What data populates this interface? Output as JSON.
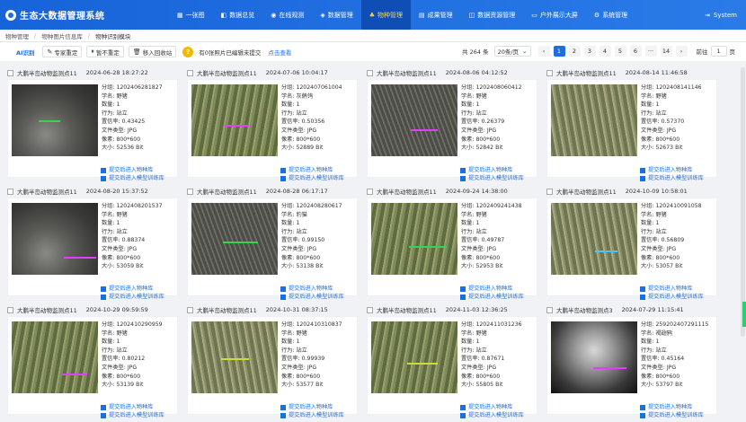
{
  "app": {
    "title": "生态大数据管理系统",
    "system_label": "System"
  },
  "nav": [
    {
      "label": "一张图",
      "icon": "map-icon"
    },
    {
      "label": "数据总览",
      "icon": "dashboard-icon"
    },
    {
      "label": "在线观测",
      "icon": "monitor-icon"
    },
    {
      "label": "数据管理",
      "icon": "data-icon"
    },
    {
      "label": "物种管理",
      "icon": "species-icon",
      "active": true
    },
    {
      "label": "成果管理",
      "icon": "result-icon"
    },
    {
      "label": "数据资源管理",
      "icon": "resource-icon"
    },
    {
      "label": "户外展示大屏",
      "icon": "screen-icon"
    },
    {
      "label": "系统管理",
      "icon": "gear-icon"
    }
  ],
  "breadcrumb": [
    "物种管理",
    "物种图片信息库",
    "物种识别模块"
  ],
  "toolbar": {
    "ai_label": "AI识别",
    "expert_label": "专家重定",
    "pause_label": "暂不重定",
    "move_label": "移入回收站",
    "notice": "有0张照片已编辑未提交",
    "notice_link": "点击查看"
  },
  "pager": {
    "total": "共 264 条",
    "size": "20条/页",
    "pages": [
      "1",
      "2",
      "3",
      "4",
      "5",
      "6",
      "···",
      "14"
    ],
    "current": "1",
    "goto_label": "前往",
    "goto_value": "1",
    "page_unit": "页"
  },
  "card_labels": {
    "group": "分组:",
    "name": "学名:",
    "count": "数量:",
    "behavior": "行为:",
    "conf": "置信率:",
    "format": "文件类型:",
    "pixels": "像素:",
    "size": "大小:",
    "link1": "提交后进入物种库",
    "link2": "提交后进入模型训练库"
  },
  "cards": [
    {
      "station": "大鹏半岛动物监测点11",
      "time": "2024-06-28 18:27:22",
      "group": "1202406281827",
      "name": "野猪",
      "count": "1",
      "behavior": "站立",
      "conf": "0.43425",
      "format": "JPG",
      "pixels": "800*600",
      "size": "52536 Bit",
      "photo": "night",
      "line": "#39d353"
    },
    {
      "station": "大鹏半岛动物监测点11",
      "time": "2024-07-06 10:04:17",
      "group": "1202407061004",
      "name": "灰鹡鸰",
      "count": "1",
      "behavior": "站立",
      "conf": "0.50356",
      "format": "JPG",
      "pixels": "800*600",
      "size": "52889 Bit",
      "photo": "day",
      "line": "#e040fb"
    },
    {
      "station": "大鹏半岛动物监测点11",
      "time": "2024-08-06 04:12:52",
      "group": "1202408060412",
      "name": "野猪",
      "count": "1",
      "behavior": "站立",
      "conf": "0.26379",
      "format": "JPG",
      "pixels": "800*600",
      "size": "52842 Bit",
      "photo": "night2",
      "line": "#e040fb"
    },
    {
      "station": "大鹏半岛动物监测点11",
      "time": "2024-08-14 11:46:58",
      "group": "1202408141146",
      "name": "野猪",
      "count": "1",
      "behavior": "站立",
      "conf": "0.57370",
      "format": "JPG",
      "pixels": "800*600",
      "size": "52673 Bit",
      "photo": "day2",
      "line": ""
    },
    {
      "station": "大鹏半岛动物监测点11",
      "time": "2024-08-20 15:37:52",
      "group": "1202408201537",
      "name": "野猪",
      "count": "1",
      "behavior": "站立",
      "conf": "0.88374",
      "format": "JPG",
      "pixels": "800*600",
      "size": "53059 Bit",
      "photo": "night",
      "line": "#e040fb"
    },
    {
      "station": "大鹏半岛动物监测点11",
      "time": "2024-08-28 06:17:17",
      "group": "1202408280617",
      "name": "豹猫",
      "count": "1",
      "behavior": "站立",
      "conf": "0.99150",
      "format": "JPG",
      "pixels": "800*600",
      "size": "53138 Bit",
      "photo": "night2",
      "line": "#39d353"
    },
    {
      "station": "大鹏半岛动物监测点11",
      "time": "2024-09-24 14:38:00",
      "group": "1202409241438",
      "name": "野猪",
      "count": "1",
      "behavior": "站立",
      "conf": "0.49787",
      "format": "JPG",
      "pixels": "800*600",
      "size": "52953 Bit",
      "photo": "day",
      "line": "#39d353"
    },
    {
      "station": "大鹏半岛动物监测点11",
      "time": "2024-10-09 10:58:01",
      "group": "1202410091058",
      "name": "野猪",
      "count": "1",
      "behavior": "站立",
      "conf": "0.56809",
      "format": "JPG",
      "pixels": "800*600",
      "size": "53057 Bit",
      "photo": "day2",
      "line": "#4fc3f7"
    },
    {
      "station": "大鹏半岛动物监测点11",
      "time": "2024-10-29 09:59:59",
      "group": "1202410290959",
      "name": "野猪",
      "count": "1",
      "behavior": "站立",
      "conf": "0.80212",
      "format": "JPG",
      "pixels": "800*600",
      "size": "53139 Bit",
      "photo": "day",
      "line": "#e040fb"
    },
    {
      "station": "大鹏半岛动物监测点11",
      "time": "2024-10-31 08:37:15",
      "group": "1202410310837",
      "name": "野猪",
      "count": "1",
      "behavior": "站立",
      "conf": "0.99939",
      "format": "JPG",
      "pixels": "800*600",
      "size": "53577 Bit",
      "photo": "day2",
      "line": "#cddc39"
    },
    {
      "station": "大鹏半岛动物监测点11",
      "time": "2024-11-03 12:36:25",
      "group": "1202411031236",
      "name": "野猪",
      "count": "1",
      "behavior": "站立",
      "conf": "0.87671",
      "format": "JPG",
      "pixels": "800*600",
      "size": "55805 Bit",
      "photo": "day",
      "line": "#cddc39"
    },
    {
      "station": "大鹏半岛动物监测点3",
      "time": "2024-07-29 11:15:41",
      "group": "259202407291115",
      "name": "褐翅鸦",
      "count": "1",
      "behavior": "站立",
      "conf": "0.45164",
      "format": "JPG",
      "pixels": "800*600",
      "size": "53797 Bit",
      "photo": "bw",
      "line": "#e040fb"
    }
  ]
}
